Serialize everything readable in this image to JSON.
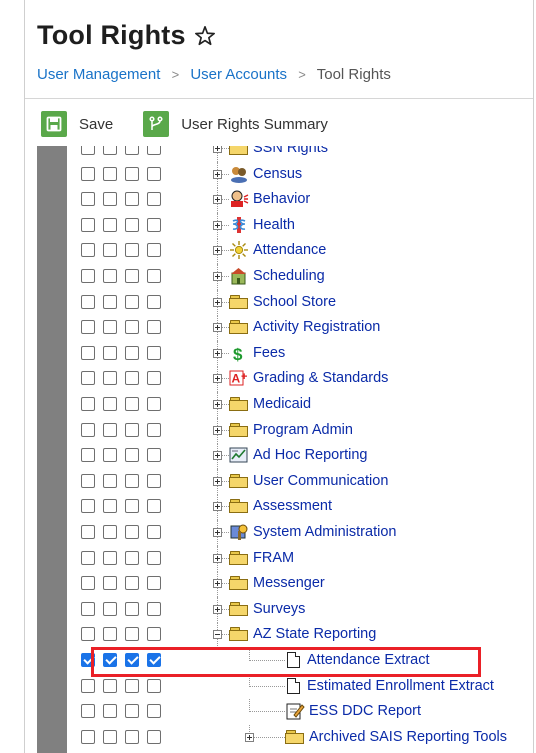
{
  "page": {
    "title": "Tool Rights"
  },
  "breadcrumb": {
    "items": [
      "User Management",
      "User Accounts",
      "Tool Rights"
    ]
  },
  "toolbar": {
    "save_label": "Save",
    "summary_label": "User Rights Summary"
  },
  "tree": {
    "rows": [
      {
        "label": "SSN Rights",
        "checks": [
          false,
          false,
          false,
          false
        ],
        "icon": "folder-icon",
        "level": 0,
        "expander": "plus"
      },
      {
        "label": "Census",
        "checks": [
          false,
          false,
          false,
          false
        ],
        "icon": "census-icon",
        "level": 0,
        "expander": "plus"
      },
      {
        "label": "Behavior",
        "checks": [
          false,
          false,
          false,
          false
        ],
        "icon": "behavior-icon",
        "level": 0,
        "expander": "plus"
      },
      {
        "label": "Health",
        "checks": [
          false,
          false,
          false,
          false
        ],
        "icon": "health-icon",
        "level": 0,
        "expander": "plus"
      },
      {
        "label": "Attendance",
        "checks": [
          false,
          false,
          false,
          false
        ],
        "icon": "attendance-icon",
        "level": 0,
        "expander": "plus"
      },
      {
        "label": "Scheduling",
        "checks": [
          false,
          false,
          false,
          false
        ],
        "icon": "scheduling-icon",
        "level": 0,
        "expander": "plus"
      },
      {
        "label": "School Store",
        "checks": [
          false,
          false,
          false,
          false
        ],
        "icon": "folder-icon",
        "level": 0,
        "expander": "plus"
      },
      {
        "label": "Activity Registration",
        "checks": [
          false,
          false,
          false,
          false
        ],
        "icon": "folder-icon",
        "level": 0,
        "expander": "plus"
      },
      {
        "label": "Fees",
        "checks": [
          false,
          false,
          false,
          false
        ],
        "icon": "fees-icon",
        "level": 0,
        "expander": "plus"
      },
      {
        "label": "Grading & Standards",
        "checks": [
          false,
          false,
          false,
          false
        ],
        "icon": "grading-icon",
        "level": 0,
        "expander": "plus"
      },
      {
        "label": "Medicaid",
        "checks": [
          false,
          false,
          false,
          false
        ],
        "icon": "folder-icon",
        "level": 0,
        "expander": "plus"
      },
      {
        "label": "Program Admin",
        "checks": [
          false,
          false,
          false,
          false
        ],
        "icon": "folder-icon",
        "level": 0,
        "expander": "plus"
      },
      {
        "label": "Ad Hoc Reporting",
        "checks": [
          false,
          false,
          false,
          false
        ],
        "icon": "ad-hoc-icon",
        "level": 0,
        "expander": "plus"
      },
      {
        "label": "User Communication",
        "checks": [
          false,
          false,
          false,
          false
        ],
        "icon": "folder-icon",
        "level": 0,
        "expander": "plus"
      },
      {
        "label": "Assessment",
        "checks": [
          false,
          false,
          false,
          false
        ],
        "icon": "folder-icon",
        "level": 0,
        "expander": "plus"
      },
      {
        "label": "System Administration",
        "checks": [
          false,
          false,
          false,
          false
        ],
        "icon": "system-admin-icon",
        "level": 0,
        "expander": "plus"
      },
      {
        "label": "FRAM",
        "checks": [
          false,
          false,
          false,
          false
        ],
        "icon": "folder-icon",
        "level": 0,
        "expander": "plus"
      },
      {
        "label": "Messenger",
        "checks": [
          false,
          false,
          false,
          false
        ],
        "icon": "folder-icon",
        "level": 0,
        "expander": "plus"
      },
      {
        "label": "Surveys",
        "checks": [
          false,
          false,
          false,
          false
        ],
        "icon": "folder-icon",
        "level": 0,
        "expander": "plus"
      },
      {
        "label": "AZ State Reporting",
        "checks": [
          false,
          false,
          false,
          false
        ],
        "icon": "folder-icon",
        "level": 0,
        "expander": "minus"
      },
      {
        "label": "Attendance Extract",
        "checks": [
          true,
          true,
          true,
          true
        ],
        "icon": "document-icon",
        "level": 1,
        "expander": "none"
      },
      {
        "label": "Estimated Enrollment Extract",
        "checks": [
          false,
          false,
          false,
          false
        ],
        "icon": "document-icon",
        "level": 1,
        "expander": "none"
      },
      {
        "label": "ESS DDC Report",
        "checks": [
          false,
          false,
          false,
          false
        ],
        "icon": "report-icon",
        "level": 1,
        "expander": "none"
      },
      {
        "label": "Archived SAIS Reporting Tools",
        "checks": [
          false,
          false,
          false,
          false
        ],
        "icon": "folder-icon",
        "level": 1,
        "expander": "plus"
      }
    ]
  },
  "colors": {
    "accent_green": "#5aa84a",
    "link_blue": "#1a73c8",
    "tree_text": "#0b2ba8",
    "highlight_red": "#ea2027",
    "check_blue": "#1a73e8"
  }
}
